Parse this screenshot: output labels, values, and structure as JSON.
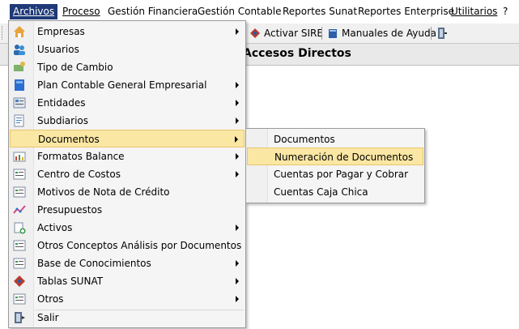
{
  "menubar": {
    "items": [
      {
        "label": "Archivos",
        "active": true
      },
      {
        "label": "Proceso"
      },
      {
        "label": "Gestión Financiera"
      },
      {
        "label": "Gestión Contable"
      },
      {
        "label": "Reportes Sunat"
      },
      {
        "label": "Reportes Enterprise"
      },
      {
        "label": "Utilitarios"
      },
      {
        "label": "?"
      }
    ]
  },
  "toolbar": {
    "activar_sire": "Activar SIRE",
    "manuales": "Manuales de Ayuda"
  },
  "panel": {
    "title": "Accesos Directos"
  },
  "archivos_menu": {
    "items": [
      {
        "label": "Empresas",
        "icon": "home-icon",
        "submenu": true
      },
      {
        "label": "Usuarios",
        "icon": "users-icon",
        "submenu": false
      },
      {
        "label": "Tipo de Cambio",
        "icon": "exchange-icon",
        "submenu": false
      },
      {
        "label": "Plan Contable General Empresarial",
        "icon": "book-icon",
        "submenu": true
      },
      {
        "label": "Entidades",
        "icon": "entities-icon",
        "submenu": true
      },
      {
        "label": "Subdiarios",
        "icon": "subdiarios-icon",
        "submenu": true
      },
      {
        "label": "Documentos",
        "icon": "none",
        "submenu": true,
        "highlighted": true
      },
      {
        "label": "Formatos Balance",
        "icon": "balance-chart-icon",
        "submenu": true
      },
      {
        "label": "Centro de Costos",
        "icon": "form-icon",
        "submenu": true
      },
      {
        "label": "Motivos de Nota de Crédito",
        "icon": "form-icon",
        "submenu": false
      },
      {
        "label": "Presupuestos",
        "icon": "trend-icon",
        "submenu": false
      },
      {
        "label": "Activos",
        "icon": "asset-icon",
        "submenu": true
      },
      {
        "label": "Otros Conceptos Análisis por Documentos",
        "icon": "form-icon",
        "submenu": false
      },
      {
        "label": "Base de Conocimientos",
        "icon": "form-icon",
        "submenu": true
      },
      {
        "label": "Tablas SUNAT",
        "icon": "sunat-icon",
        "submenu": true
      },
      {
        "label": "Otros",
        "icon": "form-icon",
        "submenu": true
      },
      {
        "label": "Salir",
        "icon": "exit-door-icon",
        "submenu": false
      }
    ]
  },
  "documentos_submenu": {
    "items": [
      {
        "label": "Documentos"
      },
      {
        "label": "Numeración de Documentos",
        "highlighted": true
      },
      {
        "label": "Cuentas por Pagar y Cobrar"
      },
      {
        "label": "Cuentas Caja Chica"
      }
    ]
  },
  "colors": {
    "menubar_active": "#1f3a78",
    "highlight": "#fbe7a4",
    "highlight_border": "#e9c66b"
  }
}
